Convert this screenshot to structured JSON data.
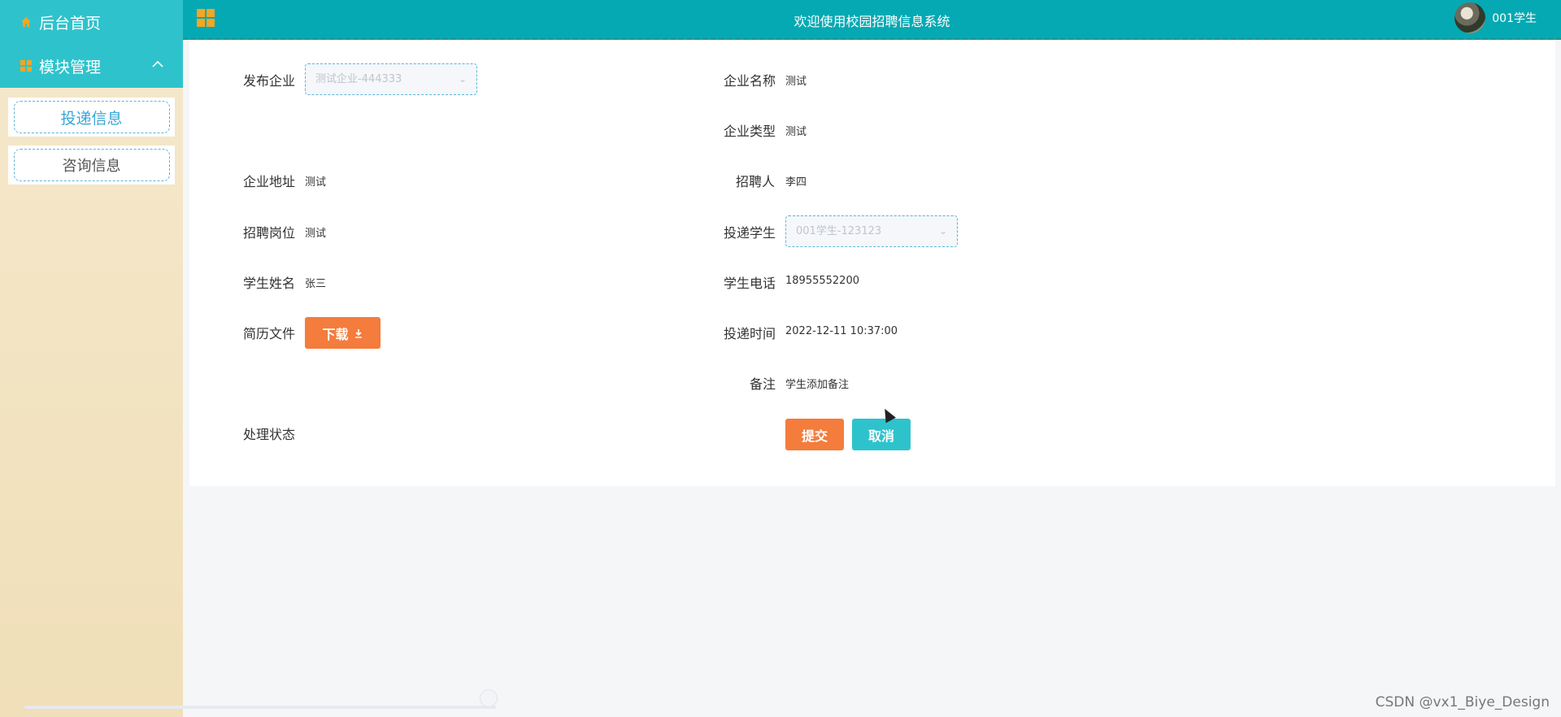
{
  "header": {
    "title": "欢迎使用校园招聘信息系统",
    "user_name": "001学生"
  },
  "sidebar": {
    "home_label": "后台首页",
    "module_label": "模块管理",
    "items": [
      {
        "label": "投递信息",
        "active": true
      },
      {
        "label": "咨询信息",
        "active": false
      }
    ]
  },
  "form": {
    "publisher_label": "发布企业",
    "publisher_value": "测试企业-444333",
    "company_name_label": "企业名称",
    "company_name_value": "测试",
    "company_type_label": "企业类型",
    "company_type_value": "测试",
    "company_address_label": "企业地址",
    "company_address_value": "测试",
    "recruiter_label": "招聘人",
    "recruiter_value": "李四",
    "position_label": "招聘岗位",
    "position_value": "测试",
    "student_label": "投递学生",
    "student_value": "001学生-123123",
    "student_name_label": "学生姓名",
    "student_name_value": "张三",
    "student_phone_label": "学生电话",
    "student_phone_value": "18955552200",
    "resume_label": "简历文件",
    "download_label": "下载",
    "delivery_time_label": "投递时间",
    "delivery_time_value": "2022-12-11 10:37:00",
    "remark_label": "备注",
    "remark_value": "学生添加备注",
    "status_label": "处理状态",
    "submit_label": "提交",
    "cancel_label": "取消"
  },
  "watermark": "CSDN @vx1_Biye_Design",
  "colors": {
    "header": "#05a9b3",
    "sidebar_top": "#2ec3cc",
    "orange": "#f47c3c",
    "teal": "#2ec3cc"
  }
}
